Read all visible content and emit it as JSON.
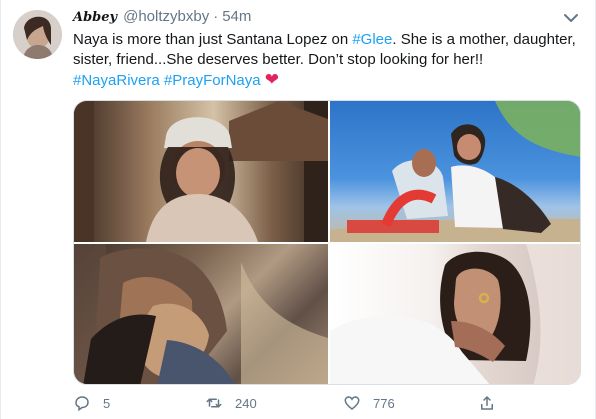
{
  "tweet": {
    "author_name": "Abbey",
    "handle": "@holtzybxby",
    "separator": "·",
    "time": "54m",
    "text_before": "Naya is more than just Santana Lopez on ",
    "hashtag_glee": "#Glee",
    "text_after": ". She is a mother, daughter, sister, friend...She deserves better. Don’t stop looking for her!!",
    "hashtag_naya": "#NayaRivera",
    "hashtag_pray": "#PrayForNaya",
    "heart_emoji": "❤"
  },
  "actions": {
    "reply_count": "5",
    "retweet_count": "240",
    "like_count": "776"
  },
  "icons": {
    "menu": "chevron-down-icon",
    "reply": "reply-icon",
    "retweet": "retweet-icon",
    "like": "heart-icon",
    "share": "share-icon"
  },
  "colors": {
    "link": "#1da1f2",
    "text": "#14171a",
    "muted": "#657786",
    "heart": "#e0245e"
  }
}
